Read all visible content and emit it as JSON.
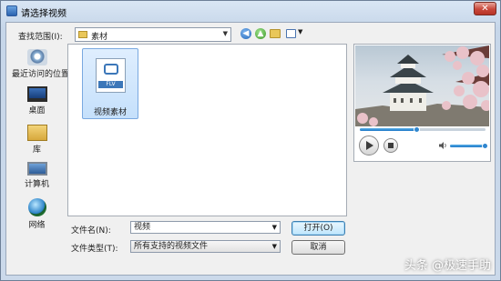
{
  "window": {
    "title": "请选择视频"
  },
  "toolbar": {
    "look_in_label": "查找范围(I):",
    "look_in_value": "素材",
    "back_icon": "back-arrow-icon",
    "up_icon": "up-folder-icon",
    "new_folder_icon": "new-folder-icon",
    "view_menu_icon": "view-menu-icon"
  },
  "places": [
    {
      "label": "最近访问的位置",
      "icon": "recent-places-icon"
    },
    {
      "label": "桌面",
      "icon": "desktop-icon"
    },
    {
      "label": "库",
      "icon": "library-icon"
    },
    {
      "label": "计算机",
      "icon": "computer-icon"
    },
    {
      "label": "网络",
      "icon": "network-icon"
    }
  ],
  "files": [
    {
      "name": "视频素材",
      "badge": "FLV",
      "selected": true
    }
  ],
  "form": {
    "filename_label": "文件名(N):",
    "filename_value": "视频",
    "filetype_label": "文件类型(T):",
    "filetype_value": "所有支持的视频文件",
    "open_button": "打开(O)",
    "cancel_button": "取消"
  },
  "preview": {
    "seek_progress": 0.45,
    "volume_level": 0.95
  },
  "watermark": "头条 @极速手助",
  "colors": {
    "accent": "#2f86cf",
    "selection": "#c5e0fb"
  }
}
